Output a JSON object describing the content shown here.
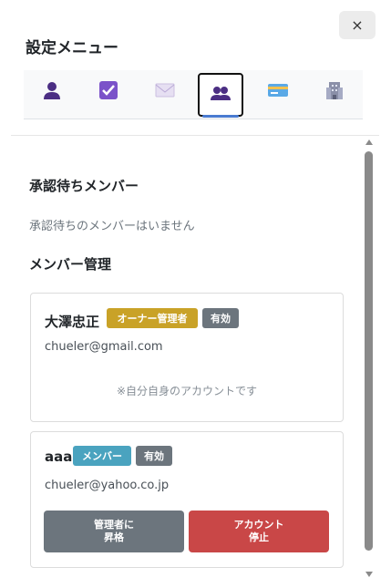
{
  "dialog": {
    "title": "設定メニュー",
    "close_label": "×"
  },
  "tabs": [
    {
      "icon": "user-icon",
      "active": false
    },
    {
      "icon": "checkbox-icon",
      "active": false
    },
    {
      "icon": "envelope-icon",
      "active": false
    },
    {
      "icon": "members-icon",
      "active": true
    },
    {
      "icon": "credit-card-icon",
      "active": false
    },
    {
      "icon": "building-icon",
      "active": false
    }
  ],
  "pending": {
    "heading": "承認待ちメンバー",
    "empty_text": "承認待ちのメンバーはいません"
  },
  "members_section": {
    "heading": "メンバー管理"
  },
  "members": [
    {
      "name": "大澤忠正",
      "role_badge": "オーナー管理者",
      "status_badge": "有効",
      "email": "chueler@gmail.com",
      "note": "※自分自身のアカウントです"
    },
    {
      "name": "aaa",
      "role_badge": "メンバー",
      "status_badge": "有効",
      "email": "chueler@yahoo.co.jp",
      "promote_line1": "管理者に",
      "promote_line2": "昇格",
      "suspend_line1": "アカウント",
      "suspend_line2": "停止"
    }
  ],
  "colors": {
    "owner_badge": "#c9a227",
    "member_badge": "#4aa3bf",
    "status_badge": "#6c757d",
    "promote_button": "#6c757d",
    "suspend_button": "#c94747"
  }
}
